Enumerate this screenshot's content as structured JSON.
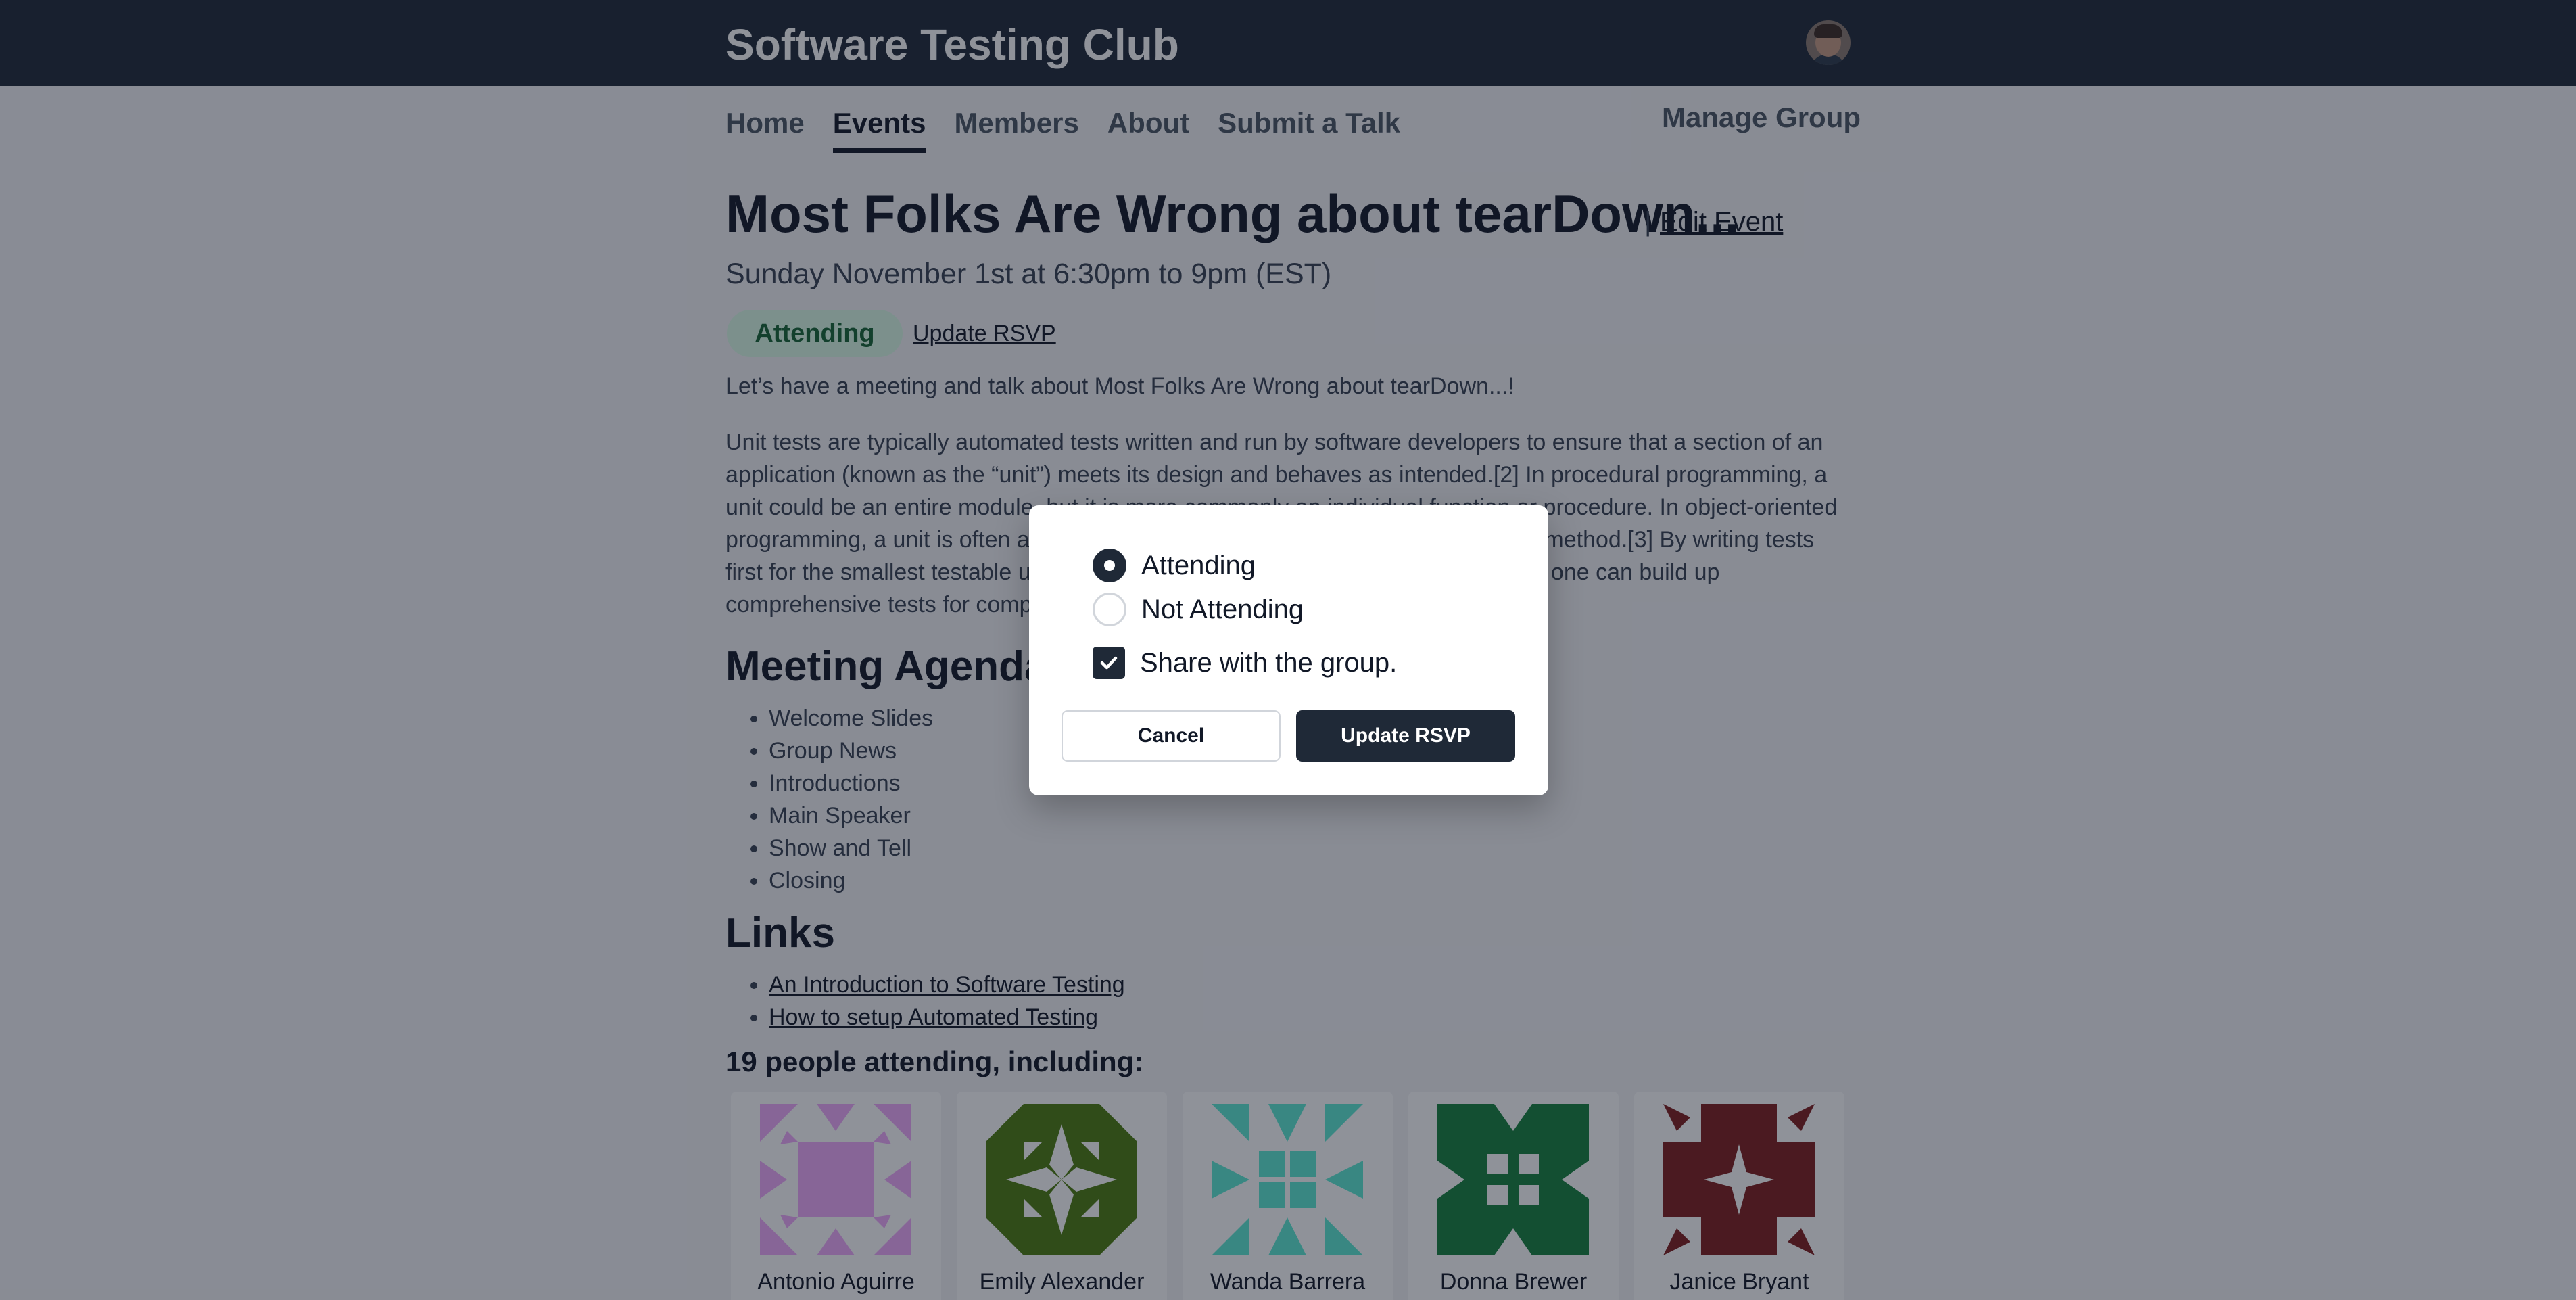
{
  "header": {
    "site_title": "Software Testing Club"
  },
  "nav": {
    "items": [
      "Home",
      "Events",
      "Members",
      "About",
      "Submit a Talk"
    ],
    "active": "Events",
    "manage_label": "Manage Group"
  },
  "event": {
    "title": "Most Folks Are Wrong about tearDown...",
    "edit_separator": "|",
    "edit_label": "Edit Event",
    "date": "Sunday November 1st at 6:30pm to 9pm (EST)",
    "status_badge": "Attending",
    "update_rsvp_link": "Update RSVP",
    "intro": "Let’s have a meeting and talk about Most Folks Are Wrong about tearDown...!",
    "description": "Unit tests are typically automated tests written and run by software developers to ensure that a section of an application (known as the “unit”) meets its design and behaves as intended.[2] In procedural programming, a unit could be an entire module, but it is more commonly an individual function or procedure. In object-oriented programming, a unit is often an entire interface, such as a class, or an individual method.[3] By writing tests first for the smallest testable units, then the compound behaviors between those, one can build up comprehensive tests for complex applications."
  },
  "agenda": {
    "heading": "Meeting Agenda",
    "items": [
      "Welcome Slides",
      "Group News",
      "Introductions",
      "Main Speaker",
      "Show and Tell",
      "Closing"
    ]
  },
  "links": {
    "heading": "Links",
    "items": [
      "An Introduction to Software Testing",
      "How to setup Automated Testing"
    ]
  },
  "attendees": {
    "heading": "19 people attending, including:",
    "people": [
      {
        "name": "Antonio Aguirre",
        "color": "#f0abfc"
      },
      {
        "name": "Emily Alexander",
        "color": "#4d7c0f"
      },
      {
        "name": "Wanda Barrera",
        "color": "#5eead4"
      },
      {
        "name": "Donna Brewer",
        "color": "#15803d"
      },
      {
        "name": "Janice Bryant",
        "color": "#7f1d1d"
      }
    ]
  },
  "modal": {
    "options": [
      "Attending",
      "Not Attending"
    ],
    "selected": "Attending",
    "share_label": "Share with the group.",
    "share_checked": true,
    "cancel_label": "Cancel",
    "submit_label": "Update RSVP"
  },
  "colors": {
    "header_bg": "#1f2937",
    "badge_bg": "#dcfce7",
    "badge_text": "#166534",
    "primary_button": "#1f2937"
  }
}
